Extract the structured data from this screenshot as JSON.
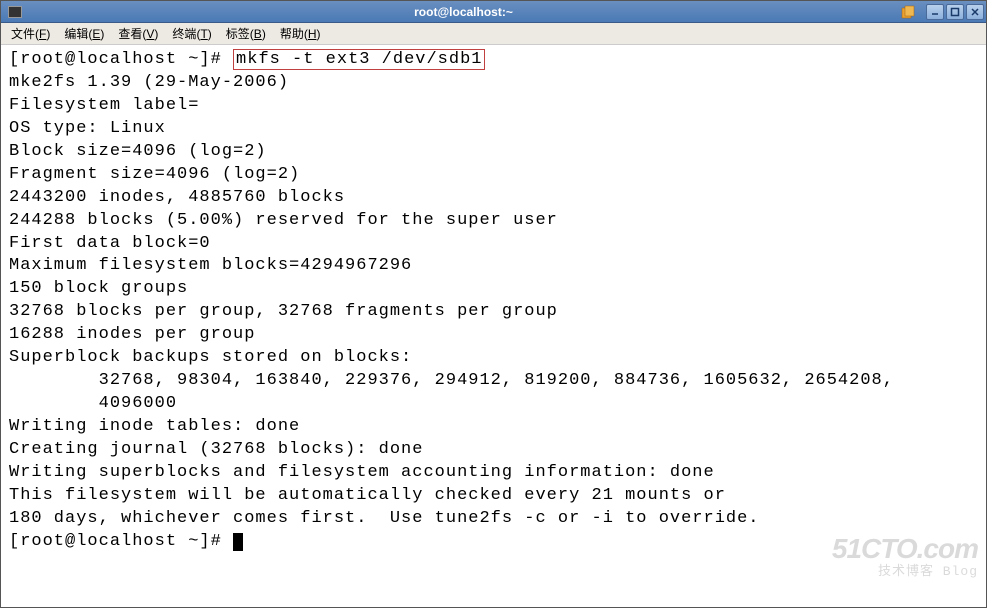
{
  "window": {
    "title": "root@localhost:~"
  },
  "menu": {
    "items": [
      {
        "label": "文件",
        "key": "F"
      },
      {
        "label": "编辑",
        "key": "E"
      },
      {
        "label": "查看",
        "key": "V"
      },
      {
        "label": "终端",
        "key": "T"
      },
      {
        "label": "标签",
        "key": "B"
      },
      {
        "label": "帮助",
        "key": "H"
      }
    ]
  },
  "terminal": {
    "prompt": "[root@localhost ~]#",
    "command": "mkfs -t ext3 /dev/sdb1",
    "lines": [
      "mke2fs 1.39 (29-May-2006)",
      "Filesystem label=",
      "OS type: Linux",
      "Block size=4096 (log=2)",
      "Fragment size=4096 (log=2)",
      "2443200 inodes, 4885760 blocks",
      "244288 blocks (5.00%) reserved for the super user",
      "First data block=0",
      "Maximum filesystem blocks=4294967296",
      "150 block groups",
      "32768 blocks per group, 32768 fragments per group",
      "16288 inodes per group",
      "Superblock backups stored on blocks:",
      "        32768, 98304, 163840, 229376, 294912, 819200, 884736, 1605632, 2654208,",
      "        4096000",
      "",
      "Writing inode tables: done",
      "Creating journal (32768 blocks): done",
      "Writing superblocks and filesystem accounting information: done",
      "",
      "This filesystem will be automatically checked every 21 mounts or",
      "180 days, whichever comes first.  Use tune2fs -c or -i to override."
    ],
    "prompt2": "[root@localhost ~]# "
  },
  "watermark": {
    "main": "51CTO.com",
    "sub": "技术博客  Blog"
  }
}
